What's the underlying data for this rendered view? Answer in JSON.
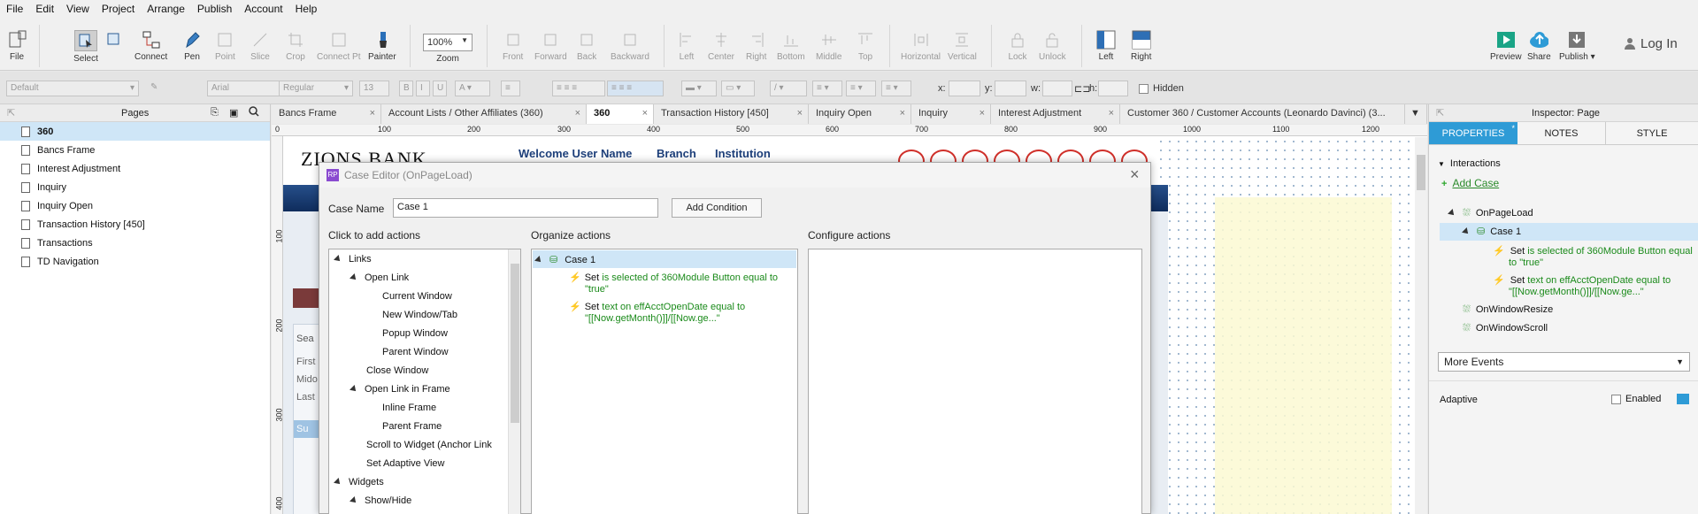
{
  "menu": [
    "File",
    "Edit",
    "View",
    "Project",
    "Arrange",
    "Publish",
    "Account",
    "Help"
  ],
  "toolbar": {
    "file": "File",
    "select": "Select",
    "connect": "Connect",
    "pen": "Pen",
    "point": "Point",
    "slice": "Slice",
    "crop": "Crop",
    "connect_point": "Connect Pt",
    "painter": "Painter",
    "zoom_value": "100%",
    "zoom": "Zoom",
    "front": "Front",
    "forward": "Forward",
    "back": "Back",
    "backward": "Backward",
    "left": "Left",
    "center": "Center",
    "right": "Right",
    "bottom": "Bottom",
    "middle": "Middle",
    "top": "Top",
    "horizontal": "Horizontal",
    "vertical": "Vertical",
    "lock": "Lock",
    "unlock": "Unlock",
    "left_align": "Left",
    "right_align": "Right",
    "preview": "Preview",
    "share": "Share",
    "publish": "Publish ▾",
    "login": "Log In"
  },
  "formatbar": {
    "style": "Default",
    "font": "Arial",
    "weight": "Regular",
    "size": "13",
    "x": "x:",
    "y": "y:",
    "w": "w:",
    "h": "h:",
    "hidden": "Hidden"
  },
  "pages": {
    "title": "Pages",
    "items": [
      "360",
      "Bancs Frame",
      "Interest Adjustment",
      "Inquiry",
      "Inquiry Open",
      "Transaction History [450]",
      "Transactions",
      "TD Navigation"
    ]
  },
  "tabs": [
    "Bancs Frame",
    "Account Lists / Other Affiliates (360)",
    "360",
    "Transaction History [450]",
    "Inquiry Open",
    "Inquiry",
    "Interest Adjustment",
    "Customer 360 / Customer Accounts (Leonardo Davinci) (3..."
  ],
  "ruler": {
    "top": [
      "0",
      "100",
      "200",
      "300",
      "400",
      "500",
      "600",
      "700",
      "800",
      "900",
      "1000",
      "1100",
      "1200"
    ],
    "left": [
      "100",
      "200",
      "300",
      "400"
    ]
  },
  "page_content": {
    "logo": "ZIONS BANK",
    "welcome": "Welcome User Name",
    "branch": "Branch",
    "institution": "Institution",
    "search": "Sea",
    "first": "First",
    "middle": "Mido",
    "last": "Last",
    "submit": "Su"
  },
  "dialog": {
    "title": "Case Editor (OnPageLoad)",
    "case_name_label": "Case Name",
    "case_name_value": "Case 1",
    "add_condition": "Add Condition",
    "col1": "Click to add actions",
    "col2": "Organize actions",
    "col3": "Configure actions",
    "actions": [
      {
        "label": "Links",
        "level": 0,
        "expand": true
      },
      {
        "label": "Open Link",
        "level": 1,
        "expand": true
      },
      {
        "label": "Current Window",
        "level": 2
      },
      {
        "label": "New Window/Tab",
        "level": 2
      },
      {
        "label": "Popup Window",
        "level": 2
      },
      {
        "label": "Parent Window",
        "level": 2
      },
      {
        "label": "Close Window",
        "level": 1
      },
      {
        "label": "Open Link in Frame",
        "level": 1,
        "expand": true
      },
      {
        "label": "Inline Frame",
        "level": 2
      },
      {
        "label": "Parent Frame",
        "level": 2
      },
      {
        "label": "Scroll to Widget (Anchor Link",
        "level": 1
      },
      {
        "label": "Set Adaptive View",
        "level": 1
      },
      {
        "label": "Widgets",
        "level": 0,
        "expand": true
      },
      {
        "label": "Show/Hide",
        "level": 1,
        "expand": true
      }
    ],
    "organize": {
      "case": "Case 1",
      "a1_set": "Set",
      "a1_text": " is selected of 360Module Button equal to",
      "a1_text2": "\"true\"",
      "a2_set": "Set",
      "a2_text": " text on effAcctOpenDate equal to",
      "a2_text2": "\"[[Now.getMonth()]]/[[Now.ge...\""
    }
  },
  "inspector": {
    "title": "Inspector: Page",
    "tab_properties": "PROPERTIES",
    "tab_notes": "NOTES",
    "tab_style": "STYLE",
    "interactions": "Interactions",
    "add_case": "Add Case",
    "onpageload": "OnPageLoad",
    "case1": "Case 1",
    "a1_set": "Set",
    "a1_text": " is selected of 360Module Button equal",
    "a1_text2": "to \"true\"",
    "a2_set": "Set",
    "a2_text": " text on effAcctOpenDate equal to",
    "a2_text2": "\"[[Now.getMonth()]]/[[Now.ge...\"",
    "onwindowresize": "OnWindowResize",
    "onwindowscroll": "OnWindowScroll",
    "more_events": "More Events",
    "adaptive": "Adaptive",
    "enabled": "Enabled"
  },
  "colors": {
    "accent": "#2e9bd6",
    "green": "#1a8a1a",
    "selection": "#cfe6f7"
  }
}
